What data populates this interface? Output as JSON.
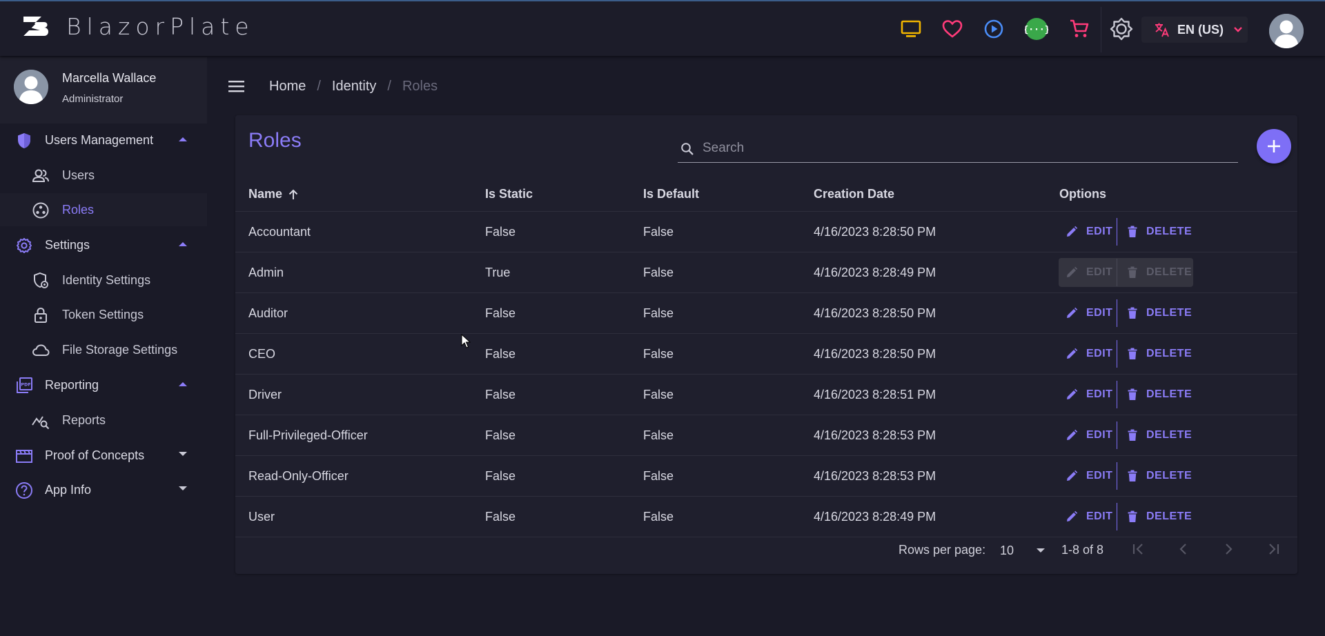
{
  "app": {
    "brand": "BlazorPlate"
  },
  "topbar": {
    "language_label": "EN (US)",
    "icons": [
      "monitor-icon",
      "heart-icon",
      "play-circle-icon",
      "api-icon",
      "cart-icon",
      "brightness-icon",
      "translate-icon"
    ],
    "colors": {
      "monitor": "#f0b400",
      "heart": "#ff3b7a",
      "play": "#4a8df8",
      "api": "#3aa84a",
      "cart": "#ff3b7a",
      "translate": "#ff3b7a"
    }
  },
  "profile": {
    "name": "Marcella Wallace",
    "role": "Administrator"
  },
  "sidebar": {
    "groups": [
      {
        "label": "Users Management",
        "items": [
          "Users",
          "Roles"
        ]
      },
      {
        "label": "Settings",
        "items": [
          "Identity Settings",
          "Token Settings",
          "File Storage Settings"
        ]
      },
      {
        "label": "Reporting",
        "items": [
          "Reports"
        ]
      },
      {
        "label": "Proof of Concepts",
        "items": []
      },
      {
        "label": "App Info",
        "items": []
      }
    ],
    "active_item": "Roles"
  },
  "breadcrumb": [
    "Home",
    "Identity",
    "Roles"
  ],
  "page": {
    "title": "Roles",
    "search_placeholder": "Search",
    "columns": [
      "Name",
      "Is Static",
      "Is Default",
      "Creation Date",
      "Options"
    ],
    "edit_label": "EDIT",
    "delete_label": "DELETE",
    "rows": [
      {
        "name": "Accountant",
        "is_static": "False",
        "is_default": "False",
        "created": "4/16/2023 8:28:50 PM",
        "disabled": false
      },
      {
        "name": "Admin",
        "is_static": "True",
        "is_default": "False",
        "created": "4/16/2023 8:28:49 PM",
        "disabled": true
      },
      {
        "name": "Auditor",
        "is_static": "False",
        "is_default": "False",
        "created": "4/16/2023 8:28:50 PM",
        "disabled": false
      },
      {
        "name": "CEO",
        "is_static": "False",
        "is_default": "False",
        "created": "4/16/2023 8:28:50 PM",
        "disabled": false
      },
      {
        "name": "Driver",
        "is_static": "False",
        "is_default": "False",
        "created": "4/16/2023 8:28:51 PM",
        "disabled": false
      },
      {
        "name": "Full-Privileged-Officer",
        "is_static": "False",
        "is_default": "False",
        "created": "4/16/2023 8:28:53 PM",
        "disabled": false
      },
      {
        "name": "Read-Only-Officer",
        "is_static": "False",
        "is_default": "False",
        "created": "4/16/2023 8:28:53 PM",
        "disabled": false
      },
      {
        "name": "User",
        "is_static": "False",
        "is_default": "False",
        "created": "4/16/2023 8:28:49 PM",
        "disabled": false
      }
    ],
    "pagination": {
      "rows_per_page_label": "Rows per page:",
      "rows_per_page": "10",
      "range": "1-8 of 8"
    }
  },
  "accent": "#8b7cf7"
}
